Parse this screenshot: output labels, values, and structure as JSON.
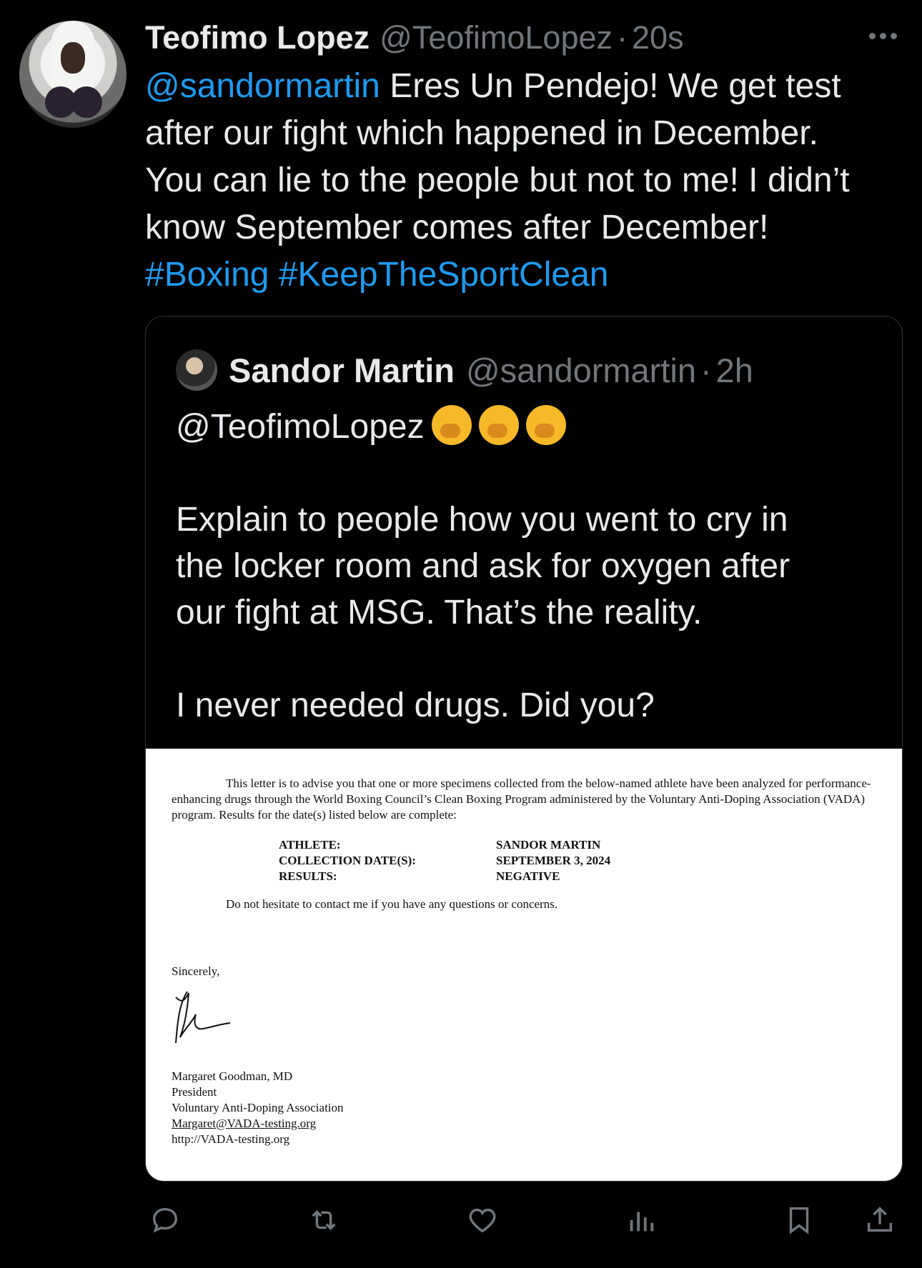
{
  "tweet": {
    "author_name": "Teofimo Lopez",
    "author_handle": "@TeofimoLopez",
    "separator": "·",
    "time": "20s",
    "mention": "@sandormartin",
    "line1_rest": " Eres Un Pendejo! We get test",
    "line2": "after our fight which happened in December.",
    "line3": "You can lie to the people but not to me! I didn’t",
    "line4": "know September comes after December!",
    "hashtag1": "#Boxing",
    "hashtag2": "#KeepTheSportClean"
  },
  "quote": {
    "author_name": "Sandor Martin",
    "author_handle": "@sandormartin",
    "separator": "·",
    "time": "2h",
    "mention": "@TeofimoLopez",
    "emojis": [
      "yawning-face",
      "yawning-face",
      "yawning-face"
    ],
    "para1_line1": "Explain to people how you went to cry in",
    "para1_line2": "the locker room and ask for oxygen after",
    "para1_line3": "our fight at MSG. That’s the reality.",
    "para2": "I never needed drugs. Did you?"
  },
  "document": {
    "intro": "This letter is to advise you that one or more specimens collected from the below-named athlete have been analyzed for performance-enhancing drugs through the World Boxing Council’s Clean Boxing Program administered by the Voluntary Anti-Doping Association (VADA) program.  Results for the date(s) listed below are complete:",
    "athlete_label": "ATHLETE:",
    "collection_label": "COLLECTION DATE(S):",
    "results_label": "RESULTS:",
    "athlete_value": "SANDOR MARTIN",
    "collection_value": "SEPTEMBER 3, 2024",
    "results_value": "NEGATIVE",
    "contact_line": "Do not hesitate to contact me if you have any questions or concerns.",
    "closing": "Sincerely,",
    "signer_name": "Margaret Goodman, MD",
    "signer_title": "President",
    "organization": "Voluntary Anti-Doping Association",
    "email": "Margaret@VADA-testing.org",
    "website": "http://VADA-testing.org"
  },
  "actions": {
    "icons": [
      "reply-icon",
      "retweet-icon",
      "like-icon",
      "views-icon",
      "bookmark-icon",
      "share-icon"
    ]
  },
  "colors": {
    "background": "#000000",
    "text": "#e7e9ea",
    "muted": "#71767b",
    "link": "#1d9bf0"
  }
}
